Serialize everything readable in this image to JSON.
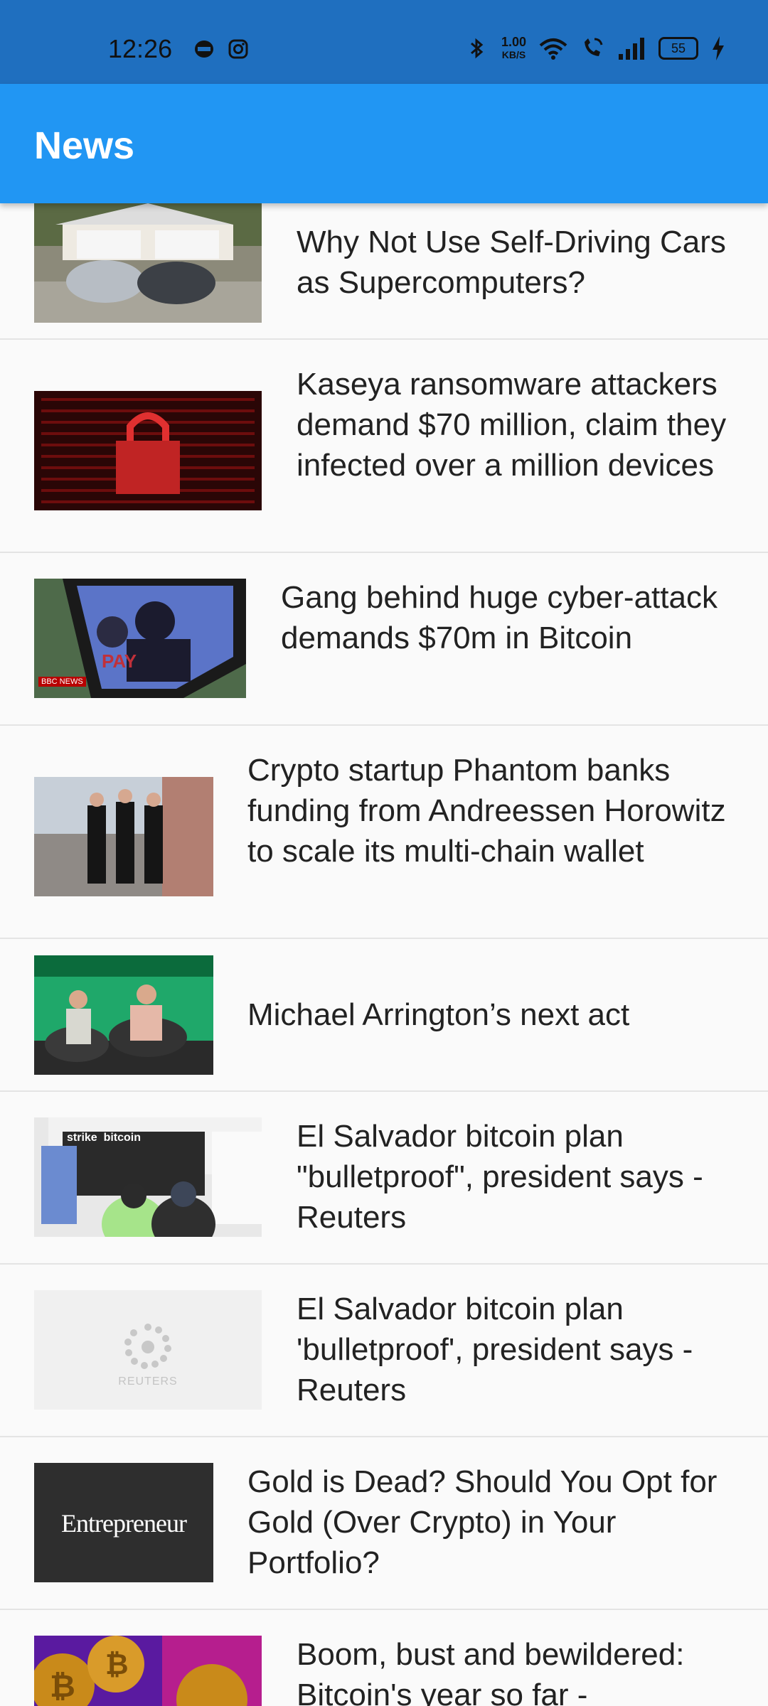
{
  "status_bar": {
    "time": "12:26",
    "net_speed_value": "1.00",
    "net_speed_unit": "KB/S",
    "battery": "55"
  },
  "app_bar": {
    "title": "News"
  },
  "articles": [
    {
      "title": "Why Not Use Self-Driving Cars as Supercomputers?",
      "thumb": "tesla-cars-photo"
    },
    {
      "title": "Kaseya ransomware attackers demand $70 million, claim they infected over a million devices",
      "thumb": "red-lock-code-image"
    },
    {
      "title": "Gang behind huge cyber-attack demands $70m in Bitcoin",
      "thumb": "hacker-laptop-photo",
      "thumb_badge": "BBC NEWS"
    },
    {
      "title": "Crypto startup Phantom banks funding from Andreessen Horowitz to scale its multi-chain wallet",
      "thumb": "founders-photo"
    },
    {
      "title": "Michael Arrington’s next act",
      "thumb": "stage-interview-photo"
    },
    {
      "title": "El Salvador bitcoin plan \"bulletproof\", president says - Reuters",
      "thumb": "strike-bitcoin-store-photo",
      "thumb_text": "strike  bitcoin"
    },
    {
      "title": "El Salvador bitcoin plan 'bulletproof', president says - Reuters",
      "thumb": "reuters-logo",
      "thumb_text": "REUTERS"
    },
    {
      "title": "Gold is Dead? Should You Opt for Gold (Over Crypto) in Your Portfolio?",
      "thumb": "entrepreneur-logo",
      "thumb_text": "Entrepreneur"
    },
    {
      "title": "Boom, bust and bewildered: Bitcoin's year so far -",
      "thumb": "bitcoin-coins-photo"
    }
  ]
}
